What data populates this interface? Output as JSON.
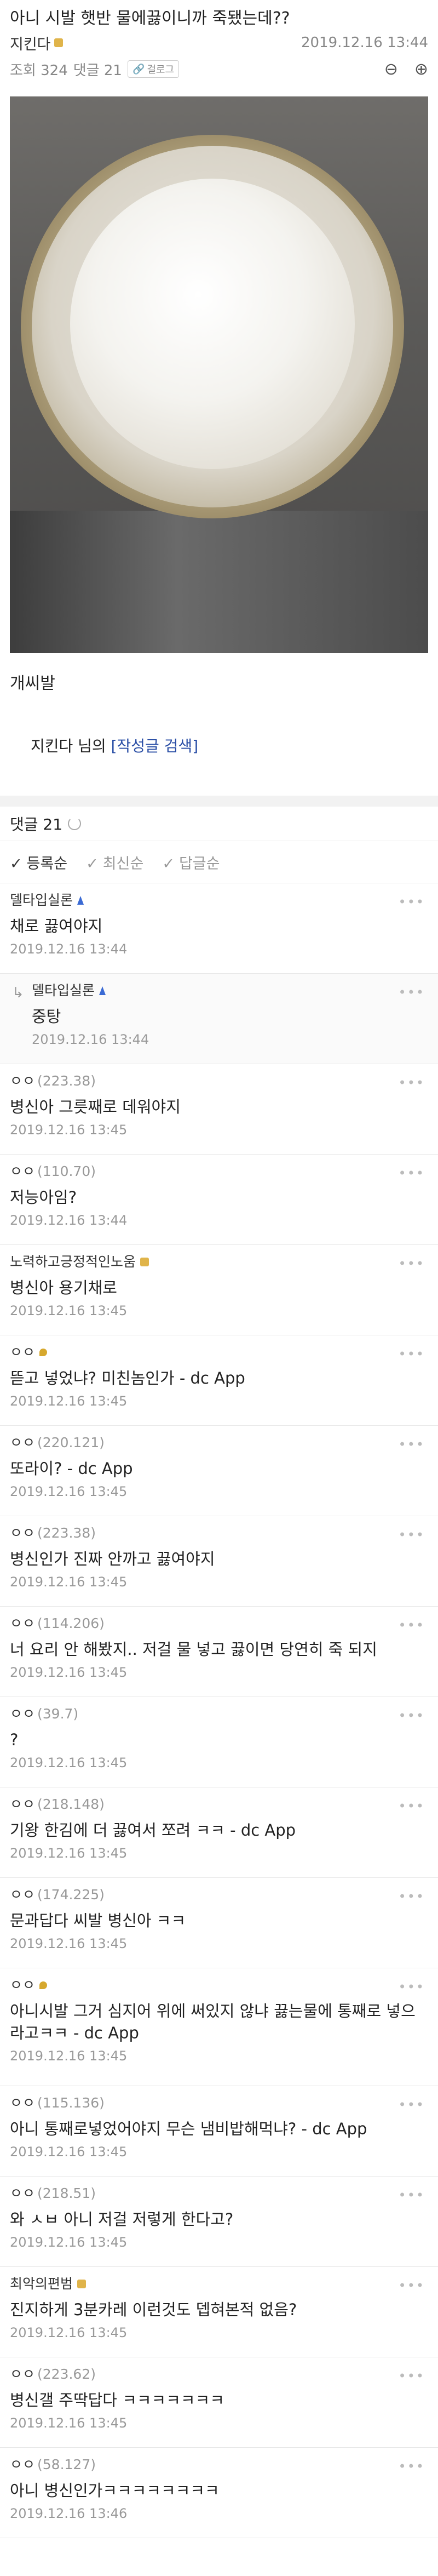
{
  "post": {
    "title": "아니 시발 햇반 물에끓이니까 죽됐는데??",
    "author": "지킨다",
    "date": "2019.12.16 13:44",
    "views_label": "조회 324",
    "comments_label": "댓글 21",
    "tag_button": "걸로그",
    "zoom_out_icon": "zoom-out-icon",
    "zoom_in_icon": "zoom-in-icon",
    "body": "개씨발",
    "author_search_name": "지킨다 님의",
    "author_search_link": "[작성글 검색]"
  },
  "comment_header": {
    "label": "댓글 21"
  },
  "sort": [
    "등록순",
    "최신순",
    "답글순"
  ],
  "comments": [
    {
      "name": "델타입실론",
      "ip": "",
      "badge": "mk",
      "text": "채로 끓여야지",
      "time": "2019.12.16 13:44",
      "reply": false
    },
    {
      "name": "델타입실론",
      "ip": "",
      "badge": "mk",
      "text": "중탕",
      "time": "2019.12.16 13:44",
      "reply": true
    },
    {
      "name": "ㅇㅇ",
      "ip": "(223.38)",
      "badge": "",
      "text": "병신아 그릇째로 데워야지",
      "time": "2019.12.16 13:45",
      "reply": false
    },
    {
      "name": "ㅇㅇ",
      "ip": "(110.70)",
      "badge": "",
      "text": "저능아임?",
      "time": "2019.12.16 13:44",
      "reply": false
    },
    {
      "name": "노력하고긍정적인노움",
      "ip": "",
      "badge": "g",
      "text": "병신아 용기채로",
      "time": "2019.12.16 13:45",
      "reply": false
    },
    {
      "name": "ㅇㅇ",
      "ip": "",
      "badge": "y",
      "text": "뜯고 넣었냐? 미친놈인가 - dc App",
      "time": "2019.12.16 13:45",
      "reply": false
    },
    {
      "name": "ㅇㅇ",
      "ip": "(220.121)",
      "badge": "",
      "text": "또라이? - dc App",
      "time": "2019.12.16 13:45",
      "reply": false
    },
    {
      "name": "ㅇㅇ",
      "ip": "(223.38)",
      "badge": "",
      "text": "병신인가 진짜 안까고 끓여야지",
      "time": "2019.12.16 13:45",
      "reply": false
    },
    {
      "name": "ㅇㅇ",
      "ip": "(114.206)",
      "badge": "",
      "text": "너 요리 안 해봤지.. 저걸 물 넣고 끓이면 당연히 죽 되지",
      "time": "2019.12.16 13:45",
      "reply": false
    },
    {
      "name": "ㅇㅇ",
      "ip": "(39.7)",
      "badge": "",
      "text": "?",
      "time": "2019.12.16 13:45",
      "reply": false
    },
    {
      "name": "ㅇㅇ",
      "ip": "(218.148)",
      "badge": "",
      "text": "기왕 한김에 더 끓여서 쪼려 ㅋㅋ - dc App",
      "time": "2019.12.16 13:45",
      "reply": false
    },
    {
      "name": "ㅇㅇ",
      "ip": "(174.225)",
      "badge": "",
      "text": "문과답다 씨발 병신아 ㅋㅋ",
      "time": "2019.12.16 13:45",
      "reply": false
    },
    {
      "name": "ㅇㅇ",
      "ip": "",
      "badge": "y",
      "text": "아니시발 그거 심지어 위에 써있지 않냐 끓는물에 통째로 넣으라고ㅋㅋ - dc App",
      "time": "2019.12.16 13:45",
      "reply": false,
      "tall": true
    },
    {
      "name": "ㅇㅇ",
      "ip": "(115.136)",
      "badge": "",
      "text": "아니 통째로넣었어야지 무슨 냄비밥해먹냐? - dc App",
      "time": "2019.12.16 13:45",
      "reply": false
    },
    {
      "name": "ㅇㅇ",
      "ip": "(218.51)",
      "badge": "",
      "text": "와 ㅅㅂ 아니 저걸 저렇게 한다고?",
      "time": "2019.12.16 13:45",
      "reply": false
    },
    {
      "name": "최악의편범",
      "ip": "",
      "badge": "g",
      "text": "진지하게 3분카레 이런것도 뎁혀본적 없음?",
      "time": "2019.12.16 13:45",
      "reply": false
    },
    {
      "name": "ㅇㅇ",
      "ip": "(223.62)",
      "badge": "",
      "text": "병신갤 주딱답다 ㅋㅋㅋㅋㅋㅋㅋ",
      "time": "2019.12.16 13:45",
      "reply": false
    },
    {
      "name": "ㅇㅇ",
      "ip": "(58.127)",
      "badge": "",
      "text": "아니 병신인가ㅋㅋㅋㅋㅋㅋㅋㅋ",
      "time": "2019.12.16 13:46",
      "reply": false
    }
  ]
}
